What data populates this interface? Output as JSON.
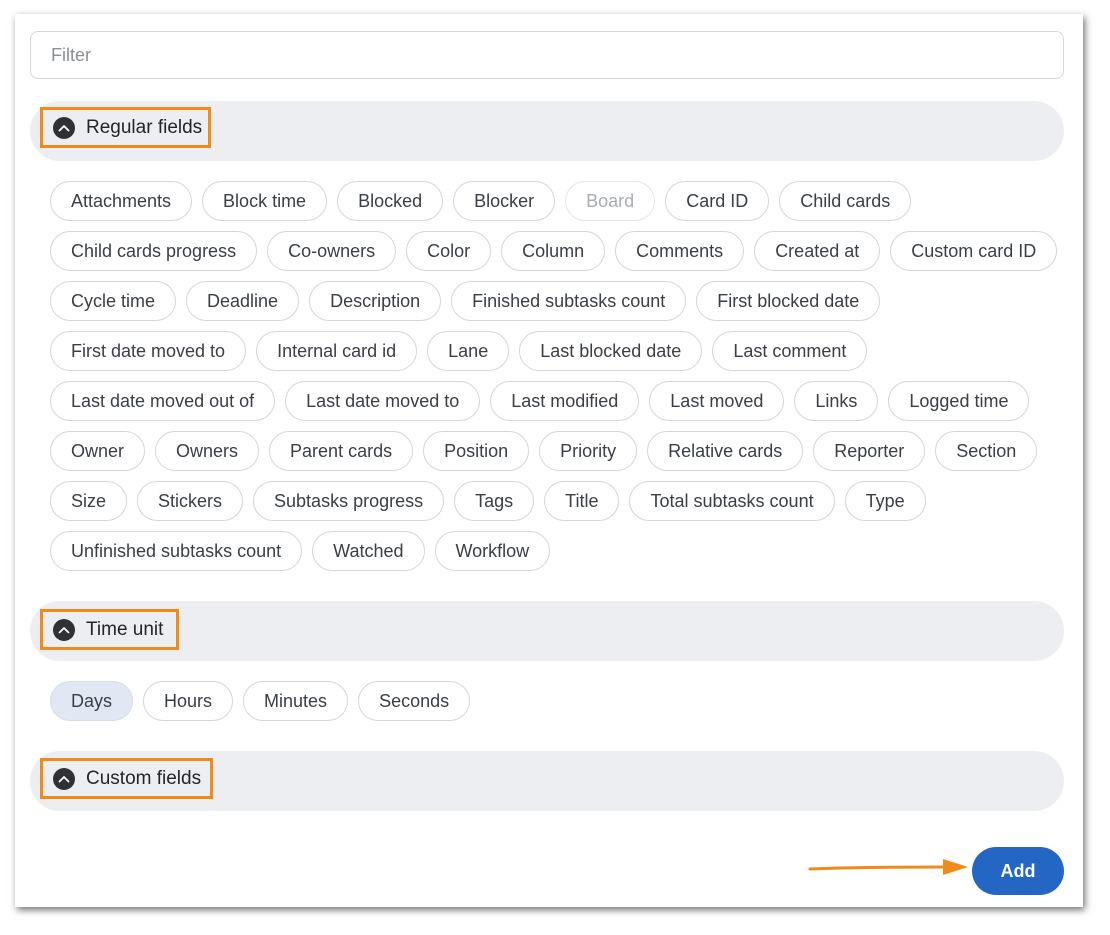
{
  "filter": {
    "placeholder": "Filter",
    "value": ""
  },
  "sections": {
    "regular": {
      "title": "Regular fields",
      "fields": [
        {
          "label": "Attachments"
        },
        {
          "label": "Block time"
        },
        {
          "label": "Blocked"
        },
        {
          "label": "Blocker"
        },
        {
          "label": "Board",
          "disabled": true
        },
        {
          "label": "Card ID"
        },
        {
          "label": "Child cards"
        },
        {
          "label": "Child cards progress"
        },
        {
          "label": "Co-owners"
        },
        {
          "label": "Color"
        },
        {
          "label": "Column"
        },
        {
          "label": "Comments"
        },
        {
          "label": "Created at"
        },
        {
          "label": "Custom card ID"
        },
        {
          "label": "Cycle time"
        },
        {
          "label": "Deadline"
        },
        {
          "label": "Description"
        },
        {
          "label": "Finished subtasks count"
        },
        {
          "label": "First blocked date"
        },
        {
          "label": "First date moved to"
        },
        {
          "label": "Internal card id"
        },
        {
          "label": "Lane"
        },
        {
          "label": "Last blocked date"
        },
        {
          "label": "Last comment"
        },
        {
          "label": "Last date moved out of"
        },
        {
          "label": "Last date moved to"
        },
        {
          "label": "Last modified"
        },
        {
          "label": "Last moved"
        },
        {
          "label": "Links"
        },
        {
          "label": "Logged time"
        },
        {
          "label": "Owner"
        },
        {
          "label": "Owners"
        },
        {
          "label": "Parent cards"
        },
        {
          "label": "Position"
        },
        {
          "label": "Priority"
        },
        {
          "label": "Relative cards"
        },
        {
          "label": "Reporter"
        },
        {
          "label": "Section"
        },
        {
          "label": "Size"
        },
        {
          "label": "Stickers"
        },
        {
          "label": "Subtasks progress"
        },
        {
          "label": "Tags"
        },
        {
          "label": "Title"
        },
        {
          "label": "Total subtasks count"
        },
        {
          "label": "Type"
        },
        {
          "label": "Unfinished subtasks count"
        },
        {
          "label": "Watched"
        },
        {
          "label": "Workflow"
        }
      ]
    },
    "time_unit": {
      "title": "Time unit",
      "options": [
        {
          "label": "Days",
          "selected": true
        },
        {
          "label": "Hours"
        },
        {
          "label": "Minutes"
        },
        {
          "label": "Seconds"
        }
      ]
    },
    "custom": {
      "title": "Custom fields"
    }
  },
  "add_button": {
    "label": "Add"
  },
  "colors": {
    "accent": "#2466c4",
    "highlight": "#f08a18",
    "header_bg": "#eceef1",
    "selected_chip": "#e1e8f3"
  },
  "icons": {
    "section_toggle": "chevron-up-icon",
    "annotation_arrow": "arrow-right-icon"
  }
}
